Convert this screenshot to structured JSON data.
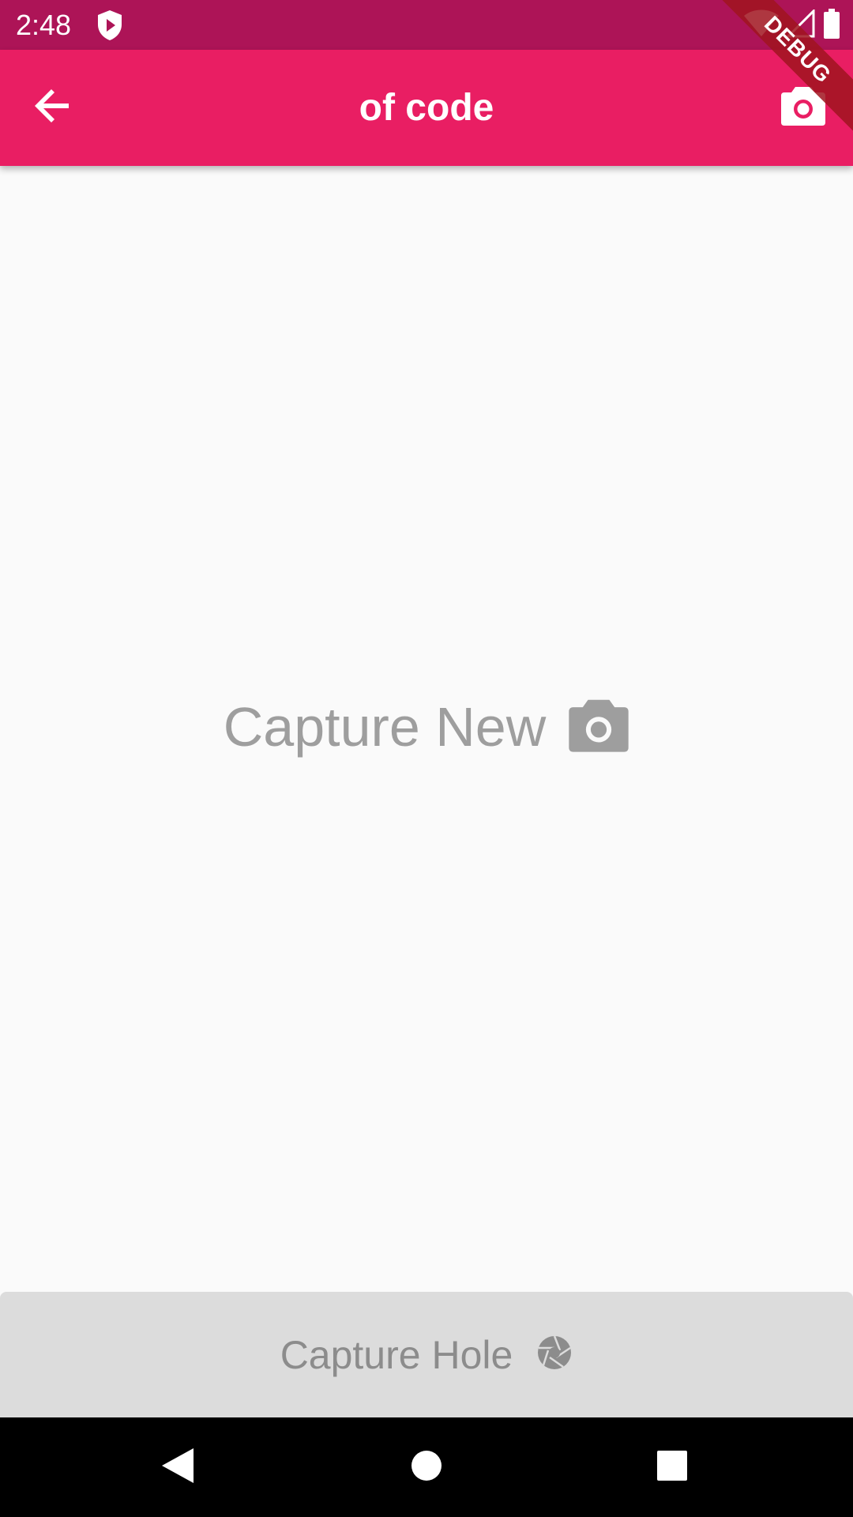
{
  "status_bar": {
    "time": "2:48",
    "shield_icon": "shield-play-icon",
    "wifi_icon": "wifi-icon",
    "signal_icon": "cell-signal-icon",
    "battery_icon": "battery-icon"
  },
  "app_bar": {
    "title": "of code",
    "back_icon": "arrow-back-icon",
    "action_icon": "camera-icon",
    "background": "#e91e63"
  },
  "debug_banner": {
    "label": "DEBUG"
  },
  "main": {
    "capture_new_label": "Capture New",
    "capture_new_icon": "camera-icon"
  },
  "bottom_button": {
    "label": "Capture Hole",
    "icon": "camera-shutter-icon"
  },
  "nav_bar": {
    "back_icon": "nav-back-icon",
    "home_icon": "nav-home-icon",
    "recents_icon": "nav-recents-icon"
  },
  "colors": {
    "status_bar": "#ad1457",
    "primary": "#e91e63",
    "background": "#fafafa",
    "muted_text": "#9e9e9e",
    "button_bg": "#dcdcdc"
  }
}
